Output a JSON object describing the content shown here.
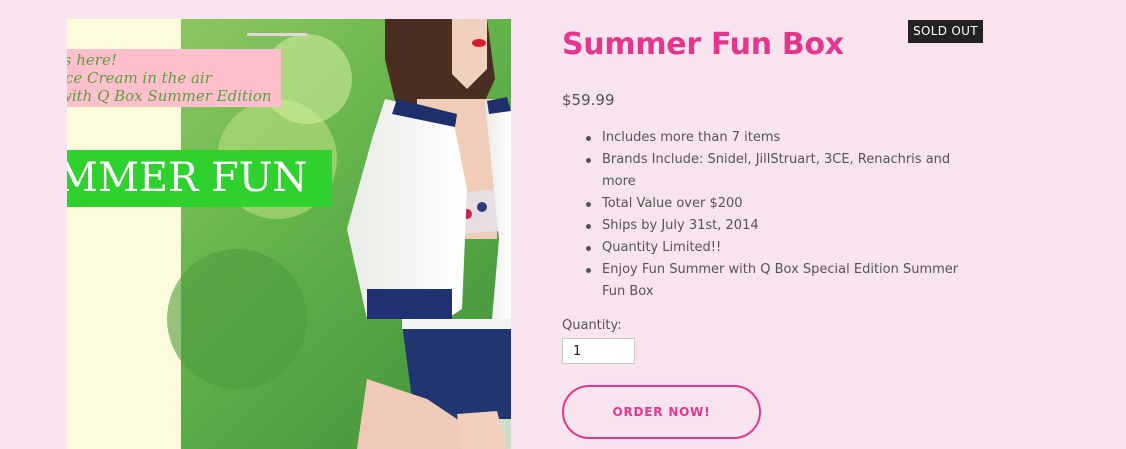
{
  "product": {
    "title": "Summer Fun Box",
    "badge": "SOLD OUT",
    "price": "$59.99",
    "features_group1": [
      "Includes more than 7 items",
      "Brands Include: Snidel, JillStruart, 3CE, Renachris and more"
    ],
    "features_group2": [
      "Total Value over $200",
      "Ships by July 31st, 2014",
      "Quantity Limited!!",
      "Enjoy Fun Summer with Q Box Special Edition Summer Fun Box"
    ]
  },
  "image": {
    "banner_lines": [
      "is here!",
      "Ice Cream in the air",
      "with Q Box Summer Edition"
    ],
    "big_text": "MMER FUN"
  },
  "order": {
    "quantity_label": "Quantity:",
    "quantity_value": "1",
    "button_label": "ORDER NOW!"
  },
  "colors": {
    "accent": "#e5358d",
    "background": "#f8e4ef",
    "badge_bg": "#222222"
  }
}
